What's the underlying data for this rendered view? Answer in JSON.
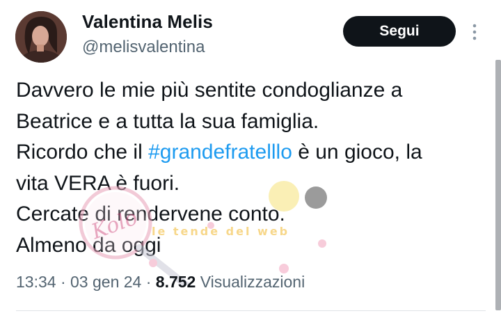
{
  "author": {
    "display_name": "Valentina Melis",
    "handle": "@melisvalentina"
  },
  "follow_button": {
    "label": "Segui"
  },
  "more_icon": "three-dots-vertical",
  "tweet": {
    "lines": [
      {
        "text": "Davvero le mie più sentite condoglianze a"
      },
      {
        "text": "Beatrice e a tutta la sua famiglia."
      },
      {
        "before": "Ricordo che il ",
        "hashtag": "#grandefratelllo",
        "after": " è un gioco, la"
      },
      {
        "text": "vita VERA è fuori."
      },
      {
        "text": "Cercate di rendervene conto."
      },
      {
        "text": "Almeno da oggi"
      }
    ]
  },
  "meta": {
    "time": "13:34",
    "separator": " · ",
    "date": "03 gen 24",
    "views_count": "8.752",
    "views_label": "Visualizzazioni"
  },
  "watermark": {
    "left_text": "Kolo",
    "right_text": "le tende del web"
  },
  "colors": {
    "text": "#0f1419",
    "secondary": "#536471",
    "hashtag": "#1d9bf0",
    "button_bg": "#0f1419"
  }
}
